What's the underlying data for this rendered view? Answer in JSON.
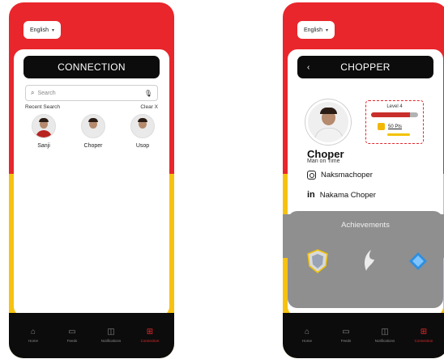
{
  "language": {
    "label": "English"
  },
  "connection_screen": {
    "title": "CONNECTION",
    "search_placeholder": "Search",
    "recent_label": "Recent Search",
    "clear_label": "Clear X",
    "contacts": [
      {
        "name": "Sanji"
      },
      {
        "name": "Choper"
      },
      {
        "name": "Usop"
      }
    ]
  },
  "profile_screen": {
    "title": "CHOPPER",
    "level_label": "Level 4",
    "level_progress": 0.82,
    "points": "50 Pts",
    "name": "Choper",
    "subtitle": "Man on Time",
    "instagram": "Naksmachoper",
    "linkedin": "Nakama Choper",
    "achievements_title": "Achievements"
  },
  "nav": {
    "items": [
      {
        "label": "Home",
        "icon": "home-icon"
      },
      {
        "label": "Feeds",
        "icon": "calendar-icon"
      },
      {
        "label": "Notifications",
        "icon": "chat-icon"
      },
      {
        "label": "Connection",
        "icon": "connection-icon"
      }
    ]
  },
  "colors": {
    "red": "#e8262b",
    "yellow": "#f7c20f",
    "black": "#0c0c0c",
    "grey": "#8f8f8f"
  }
}
